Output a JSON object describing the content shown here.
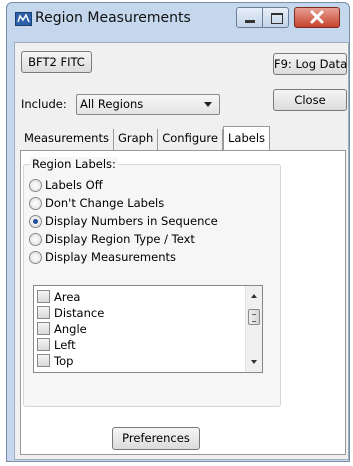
{
  "window": {
    "title": "Region Measurements",
    "controls": {
      "minimize": "minimize",
      "maximize": "maximize",
      "close": "close"
    },
    "accent_color": "#c4d7ec",
    "close_color": "#c3432e"
  },
  "toolbar": {
    "id_button_label": "BFT2 FITC",
    "log_button_label": "F9: Log Data",
    "include_label": "Include:",
    "include_value": "All Regions",
    "close_button_label": "Close"
  },
  "tabs": [
    {
      "label": "Measurements",
      "active": false
    },
    {
      "label": "Graph",
      "active": false
    },
    {
      "label": "Configure",
      "active": false
    },
    {
      "label": "Labels",
      "active": true
    }
  ],
  "labels_tab": {
    "group_title": "Region Labels:",
    "options": [
      {
        "label": "Labels Off",
        "checked": false
      },
      {
        "label": "Don't Change Labels",
        "checked": false
      },
      {
        "label": "Display Numbers in Sequence",
        "checked": true
      },
      {
        "label": "Display Region Type / Text",
        "checked": false
      },
      {
        "label": "Display Measurements",
        "checked": false
      }
    ],
    "measurements": [
      "Area",
      "Distance",
      "Angle",
      "Left",
      "Top"
    ],
    "preferences_label": "Preferences"
  }
}
